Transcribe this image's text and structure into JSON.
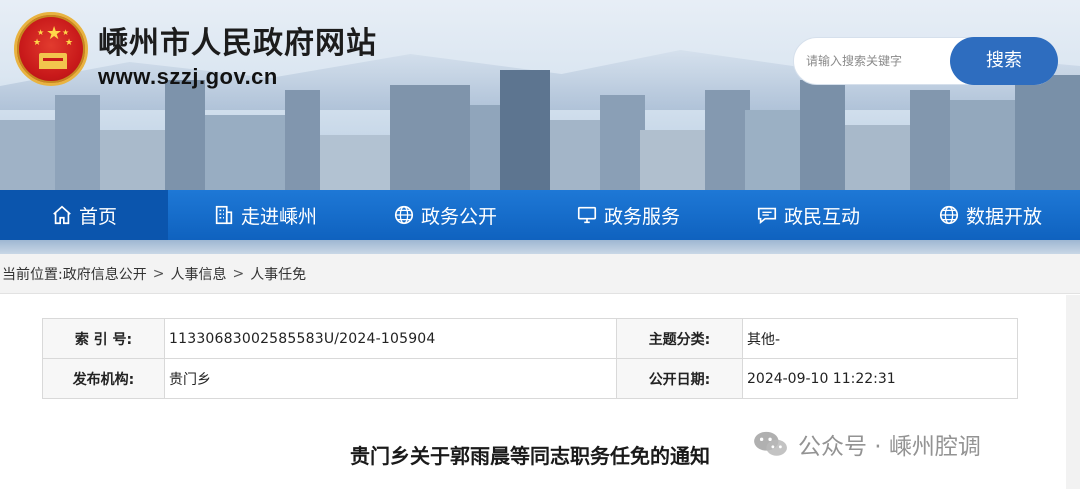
{
  "header": {
    "site_title": "嵊州市人民政府网站",
    "site_url": "www.szzj.gov.cn",
    "search_placeholder": "请输入搜索关键字",
    "search_button": "搜索"
  },
  "nav": {
    "items": [
      {
        "label": "首页",
        "icon": "home-icon",
        "active": true
      },
      {
        "label": "走进嵊州",
        "icon": "building-icon",
        "active": false
      },
      {
        "label": "政务公开",
        "icon": "globe-icon",
        "active": false
      },
      {
        "label": "政务服务",
        "icon": "monitor-icon",
        "active": false
      },
      {
        "label": "政民互动",
        "icon": "chat-icon",
        "active": false
      },
      {
        "label": "数据开放",
        "icon": "globe-icon",
        "active": false
      }
    ]
  },
  "breadcrumb": {
    "prefix": "当前位置:",
    "items": [
      "政府信息公开",
      "人事信息",
      "人事任免"
    ],
    "separator": ">"
  },
  "info": {
    "index_label": "索 引 号:",
    "index_value": "11330683002585583U/2024-105904",
    "topic_label": "主题分类:",
    "topic_value": "其他-",
    "org_label": "发布机构:",
    "org_value": "贵门乡",
    "date_label": "公开日期:",
    "date_value": "2024-09-10 11:22:31"
  },
  "article": {
    "title": "贵门乡关于郭雨晨等同志职务任免的通知"
  },
  "watermark": {
    "text": "公众号 · 嵊州腔调",
    "icon": "wechat-icon"
  },
  "colors": {
    "nav_blue": "#1e78d6",
    "nav_active": "#0b55ad",
    "search_blue": "#2e6dbf"
  }
}
